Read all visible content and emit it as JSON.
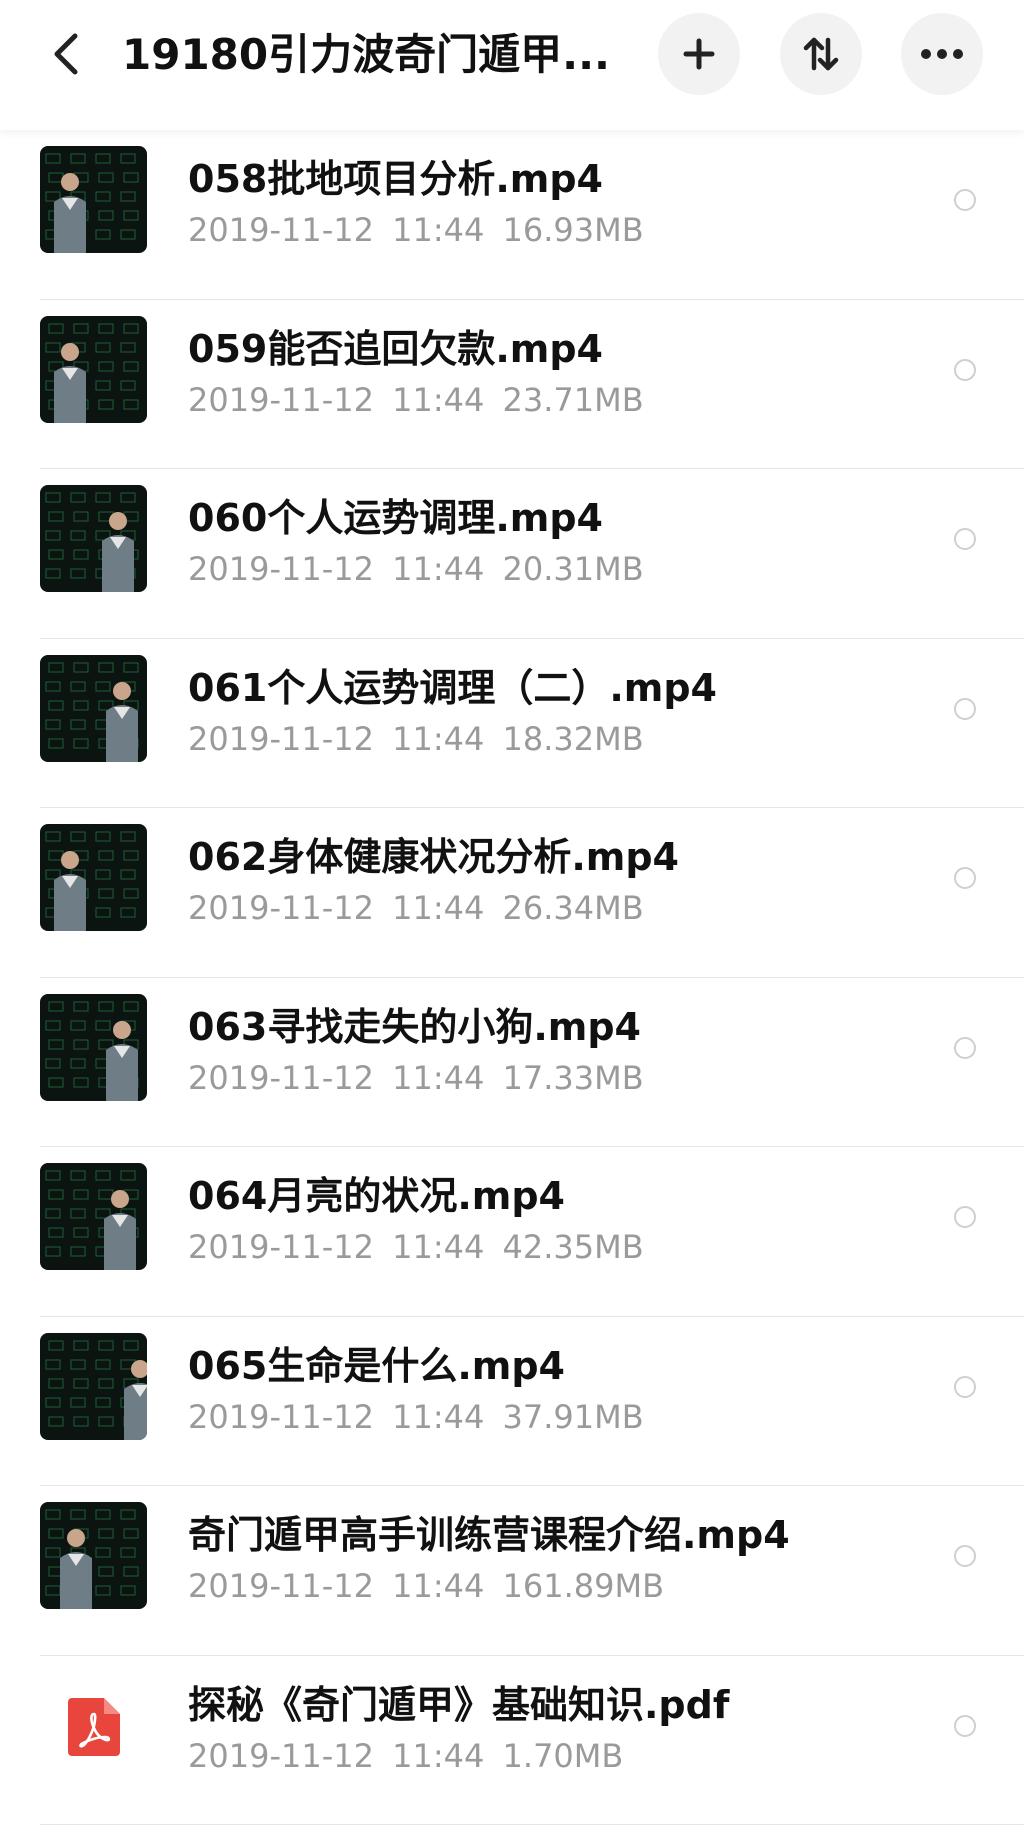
{
  "header": {
    "title": "19180引力波奇门遁甲..."
  },
  "files": [
    {
      "name": "058批地项目分析.mp4",
      "date": "2019-11-12",
      "time": "11:44",
      "size": "16.93MB",
      "type": "video",
      "icon": "video-thumbnail"
    },
    {
      "name": "059能否追回欠款.mp4",
      "date": "2019-11-12",
      "time": "11:44",
      "size": "23.71MB",
      "type": "video",
      "icon": "video-thumbnail"
    },
    {
      "name": "060个人运势调理.mp4",
      "date": "2019-11-12",
      "time": "11:44",
      "size": "20.31MB",
      "type": "video",
      "icon": "video-thumbnail"
    },
    {
      "name": "061个人运势调理（二）.mp4",
      "date": "2019-11-12",
      "time": "11:44",
      "size": "18.32MB",
      "type": "video",
      "icon": "video-thumbnail"
    },
    {
      "name": "062身体健康状况分析.mp4",
      "date": "2019-11-12",
      "time": "11:44",
      "size": "26.34MB",
      "type": "video",
      "icon": "video-thumbnail"
    },
    {
      "name": "063寻找走失的小狗.mp4",
      "date": "2019-11-12",
      "time": "11:44",
      "size": "17.33MB",
      "type": "video",
      "icon": "video-thumbnail"
    },
    {
      "name": "064月亮的状况.mp4",
      "date": "2019-11-12",
      "time": "11:44",
      "size": "42.35MB",
      "type": "video",
      "icon": "video-thumbnail"
    },
    {
      "name": "065生命是什么.mp4",
      "date": "2019-11-12",
      "time": "11:44",
      "size": "37.91MB",
      "type": "video",
      "icon": "video-thumbnail"
    },
    {
      "name": "奇门遁甲高手训练营课程介绍.mp4",
      "date": "2019-11-12",
      "time": "11:44",
      "size": "161.89MB",
      "type": "video",
      "icon": "video-thumbnail"
    },
    {
      "name": "探秘《奇门遁甲》基础知识.pdf",
      "date": "2019-11-12",
      "time": "11:44",
      "size": "1.70MB",
      "type": "pdf",
      "icon": "pdf-icon"
    }
  ],
  "colors": {
    "pdf_red": "#e8453c",
    "meta_gray": "#9a9a9a",
    "thumb_bg": "#0b1410",
    "thumb_grid": "#2f9e58"
  }
}
